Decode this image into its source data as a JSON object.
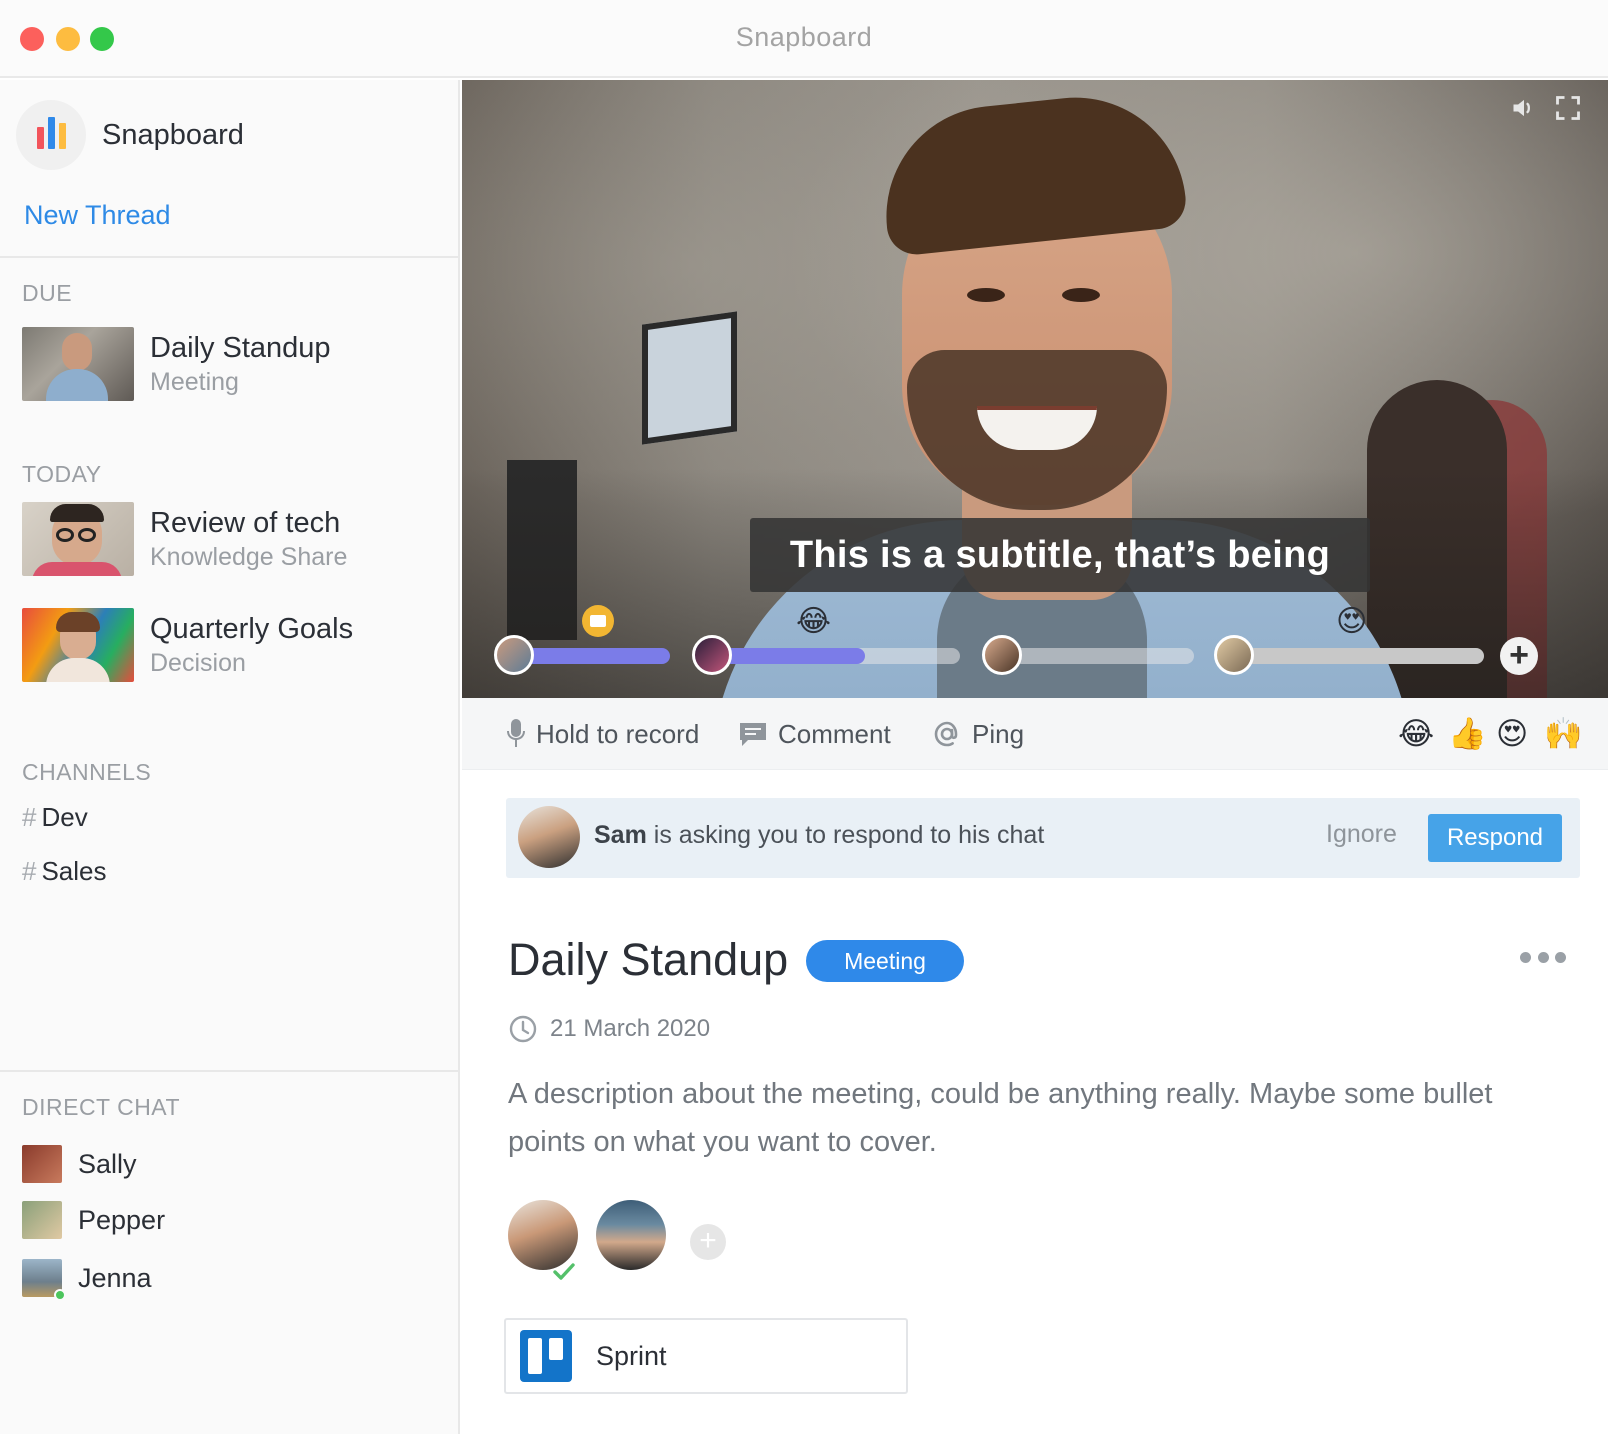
{
  "window": {
    "title": "Snapboard"
  },
  "brand": {
    "name": "Snapboard",
    "logo_colors": [
      "#f2545b",
      "#2f89e9",
      "#fdbc40"
    ]
  },
  "sidebar": {
    "new_thread_label": "New Thread",
    "sections": {
      "due": "DUE",
      "today": "TODAY",
      "channels": "CHANNELS",
      "direct_chat": "DIRECT CHAT"
    },
    "due_threads": [
      {
        "title": "Daily Standup",
        "type": "Meeting"
      }
    ],
    "today_threads": [
      {
        "title": "Review of tech",
        "type": "Knowledge Share"
      },
      {
        "title": "Quarterly Goals",
        "type": "Decision"
      }
    ],
    "channel_prefix": "#",
    "channels": [
      {
        "name": "Dev"
      },
      {
        "name": "Sales"
      }
    ],
    "direct_chats": [
      {
        "name": "Sally",
        "online": false
      },
      {
        "name": "Pepper",
        "online": false
      },
      {
        "name": "Jenna",
        "online": true
      }
    ]
  },
  "video": {
    "subtitle": "This is a subtitle, that’s being",
    "controls": {
      "volume_icon": "speaker-icon",
      "fullscreen_icon": "fullscreen-icon"
    },
    "reactions_on_timeline": [
      "😂",
      "😍"
    ],
    "add_label": "+"
  },
  "actions": {
    "record_label": "Hold to record",
    "comment_label": "Comment",
    "ping_label": "Ping",
    "reactions": [
      "😂",
      "👍",
      "😍",
      "🙌"
    ]
  },
  "request": {
    "sender": "Sam",
    "message": " is asking you to respond to his chat",
    "ignore_label": "Ignore",
    "respond_label": "Respond"
  },
  "detail": {
    "title": "Daily Standup",
    "badge": "Meeting",
    "date": "21 March 2020",
    "description": "A description about the meeting, could be anything really. Maybe some bullet points on what you want to cover.",
    "add_participant_label": "+",
    "attachment": {
      "name": "Sprint",
      "icon": "trello-icon"
    }
  },
  "colors": {
    "accent": "#2f89e9",
    "respond": "#46a3e8",
    "timeline_fill": "#7b7ce8",
    "online": "#4cc55c"
  }
}
